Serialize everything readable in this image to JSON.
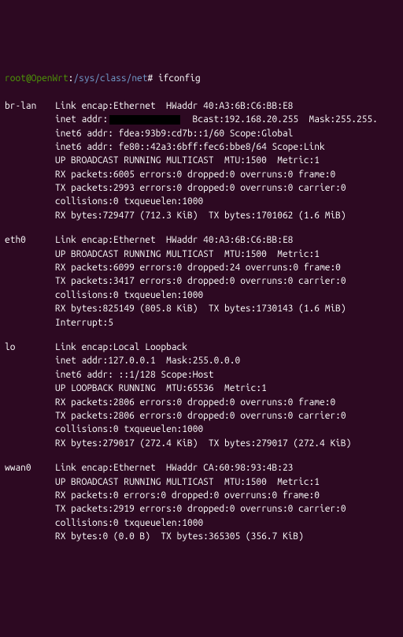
{
  "prompt": {
    "user": "root",
    "host": "OpenWrt",
    "path": "/sys/class/net",
    "command": "ifconfig"
  },
  "interfaces": [
    {
      "name": "br-lan",
      "lines": [
        "Link encap:Ethernet  HWaddr 40:A3:6B:C6:BB:E8",
        [
          "inet addr:",
          "CENSOR",
          "  Bcast:192.168.20.255  Mask:255.255."
        ],
        "inet6 addr: fdea:93b9:cd7b::1/60 Scope:Global",
        "inet6 addr: fe80::42a3:6bff:fec6:bbe8/64 Scope:Link",
        "UP BROADCAST RUNNING MULTICAST  MTU:1500  Metric:1",
        "RX packets:6005 errors:0 dropped:0 overruns:0 frame:0",
        "TX packets:2993 errors:0 dropped:0 overruns:0 carrier:0",
        "collisions:0 txqueuelen:1000",
        "RX bytes:729477 (712.3 KiB)  TX bytes:1701062 (1.6 MiB)"
      ]
    },
    {
      "name": "eth0",
      "lines": [
        "Link encap:Ethernet  HWaddr 40:A3:6B:C6:BB:E8",
        "UP BROADCAST RUNNING MULTICAST  MTU:1500  Metric:1",
        "RX packets:6099 errors:0 dropped:24 overruns:0 frame:0",
        "TX packets:3417 errors:0 dropped:0 overruns:0 carrier:0",
        "collisions:0 txqueuelen:1000",
        "RX bytes:825149 (805.8 KiB)  TX bytes:1730143 (1.6 MiB)",
        "Interrupt:5"
      ]
    },
    {
      "name": "lo",
      "lines": [
        "Link encap:Local Loopback",
        "inet addr:127.0.0.1  Mask:255.0.0.0",
        "inet6 addr: ::1/128 Scope:Host",
        "UP LOOPBACK RUNNING  MTU:65536  Metric:1",
        "RX packets:2806 errors:0 dropped:0 overruns:0 frame:0",
        "TX packets:2806 errors:0 dropped:0 overruns:0 carrier:0",
        "collisions:0 txqueuelen:1000",
        "RX bytes:279017 (272.4 KiB)  TX bytes:279017 (272.4 KiB)"
      ]
    },
    {
      "name": "wwan0",
      "lines": [
        "Link encap:Ethernet  HWaddr CA:60:98:93:4B:23",
        "UP BROADCAST RUNNING MULTICAST  MTU:1500  Metric:1",
        "RX packets:0 errors:0 dropped:0 overruns:0 frame:0",
        "TX packets:2919 errors:0 dropped:0 overruns:0 carrier:0",
        "collisions:0 txqueuelen:1000",
        "RX bytes:0 (0.0 B)  TX bytes:365305 (356.7 KiB)"
      ]
    }
  ]
}
